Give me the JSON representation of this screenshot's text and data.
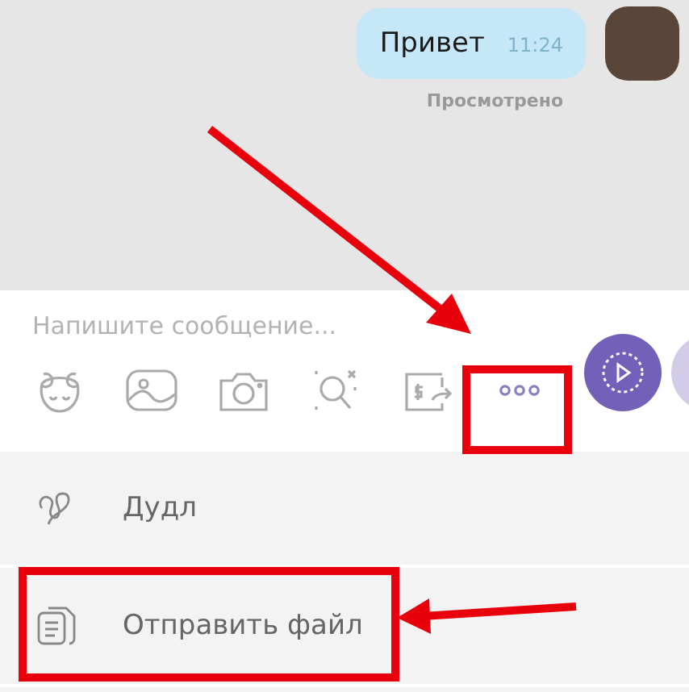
{
  "chat": {
    "message": {
      "text": "Привет",
      "time": "11:24",
      "status": "Просмотрено"
    }
  },
  "composer": {
    "placeholder": "Напишите сообщение..."
  },
  "menu": [
    {
      "label": "Дудл",
      "kind": "doodle"
    },
    {
      "label": "Отправить файл",
      "kind": "file"
    }
  ]
}
